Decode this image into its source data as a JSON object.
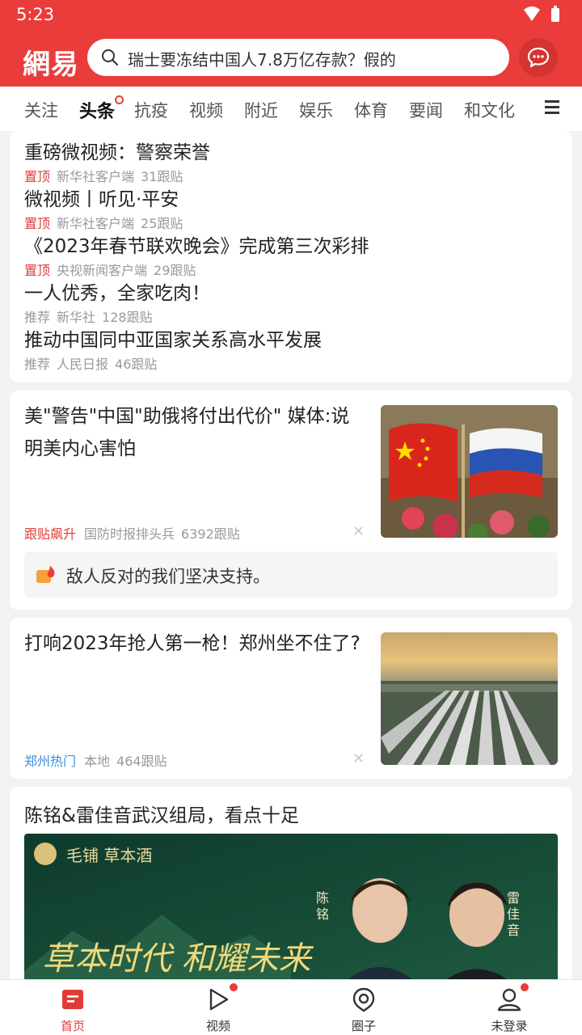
{
  "status_bar": {
    "time": "5:23"
  },
  "header": {
    "logo": "網易",
    "search_placeholder": "瑞士要冻结中国人7.8万亿存款？假的",
    "brand_color": "#ea3c3a"
  },
  "tabs": [
    "关注",
    "头条",
    "抗疫",
    "视频",
    "附近",
    "娱乐",
    "体育",
    "要闻",
    "和文化"
  ],
  "active_tab": "头条",
  "pinned": [
    {
      "title": "重磅微视频：警察荣誉",
      "tag": "置顶",
      "source": "新华社客户端",
      "comments": "31跟贴"
    },
    {
      "title": "微视频丨听见·平安",
      "tag": "置顶",
      "source": "新华社客户端",
      "comments": "25跟贴"
    },
    {
      "title": "《2023年春节联欢晚会》完成第三次彩排",
      "tag": "置顶",
      "source": "央视新闻客户端",
      "comments": "29跟贴"
    },
    {
      "title": "一人优秀，全家吃肉！",
      "tag": "推荐",
      "source": "新华社",
      "comments": "128跟贴"
    },
    {
      "title": "推动中国同中亚国家关系高水平发展",
      "tag": "推荐",
      "source": "人民日报",
      "comments": "46跟贴"
    }
  ],
  "news": [
    {
      "title": "美\"警告\"中国\"助俄将付出代价\" 媒体:说明美内心害怕",
      "tag": "跟贴飙升",
      "source": "国防时报排头兵",
      "comments": "6392跟贴",
      "hot_comment": "敌人反对的我们坚决支持。"
    },
    {
      "title": "打响2023年抢人第一枪！郑州坐不住了?",
      "tag": "郑州热门",
      "source": "本地",
      "comments": "464跟贴"
    }
  ],
  "feature": {
    "title": "陈铭&雷佳音武汉组局，看点十足",
    "ad_brand": "毛铺 草本酒",
    "ad_slogan": "草本时代 和耀未来",
    "person_left": "陈铭",
    "person_right": "雷佳音"
  },
  "bottom_nav": [
    {
      "label": "首页",
      "icon": "home-icon"
    },
    {
      "label": "视频",
      "icon": "play-icon"
    },
    {
      "label": "圈子",
      "icon": "circle-icon"
    },
    {
      "label": "未登录",
      "icon": "user-icon"
    }
  ]
}
